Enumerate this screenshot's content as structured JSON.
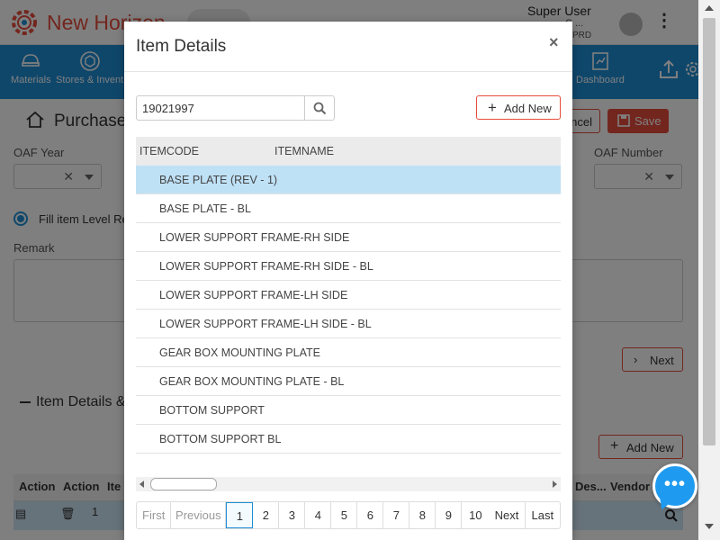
{
  "app": {
    "title": "New Horizon",
    "user_name": "Super User",
    "user_company": "C ...",
    "user_env": "PRD"
  },
  "menu": {
    "items": [
      {
        "label": "Materials"
      },
      {
        "label": "Stores & Invent"
      },
      {
        "label": "Dashboard"
      }
    ]
  },
  "page": {
    "title": "Purchase",
    "cancel_label": "ncel",
    "save_label": "Save",
    "oaf_year_label": "OAF Year",
    "oaf_number_label": "OAF Number",
    "fill_item_label": "Fill item Level Re",
    "remark_label": "Remark",
    "next_label": "Next",
    "section_title": "Item Details &",
    "add_new_label": "Add New",
    "grid_headers": [
      "Action",
      "Action",
      "Ite",
      "Des...",
      "Vendor I"
    ],
    "grid_row_value": "1"
  },
  "modal": {
    "title": "Item Details",
    "close": "×",
    "search_value": "19021997",
    "add_new_label": "Add New",
    "columns": [
      "ITEMCODE",
      "ITEMNAME"
    ],
    "rows": [
      {
        "name": "BASE PLATE (REV - 1)",
        "selected": true
      },
      {
        "name": "BASE PLATE - BL",
        "selected": false
      },
      {
        "name": "LOWER SUPPORT FRAME-RH SIDE",
        "selected": false
      },
      {
        "name": "LOWER SUPPORT FRAME-RH SIDE - BL",
        "selected": false
      },
      {
        "name": "LOWER SUPPORT FRAME-LH SIDE",
        "selected": false
      },
      {
        "name": "LOWER SUPPORT FRAME-LH SIDE - BL",
        "selected": false
      },
      {
        "name": "GEAR BOX MOUNTING PLATE",
        "selected": false
      },
      {
        "name": "GEAR BOX MOUNTING PLATE - BL",
        "selected": false
      },
      {
        "name": "BOTTOM SUPPORT",
        "selected": false
      },
      {
        "name": "BOTTOM SUPPORT BL",
        "selected": false
      }
    ],
    "pagination": {
      "first": "First",
      "previous": "Previous",
      "pages": [
        "1",
        "2",
        "3",
        "4",
        "5",
        "6",
        "7",
        "8",
        "9",
        "10"
      ],
      "active_page": "1",
      "next": "Next",
      "last": "Last"
    }
  },
  "chat": {
    "icon": "chat-bubble-icon",
    "dots": "•••"
  },
  "colors": {
    "accent_blue": "#1e8fd6",
    "brand_red": "#e74c3c",
    "selected_row": "#bfe1f6",
    "chat_blue": "#1e9bf0"
  }
}
